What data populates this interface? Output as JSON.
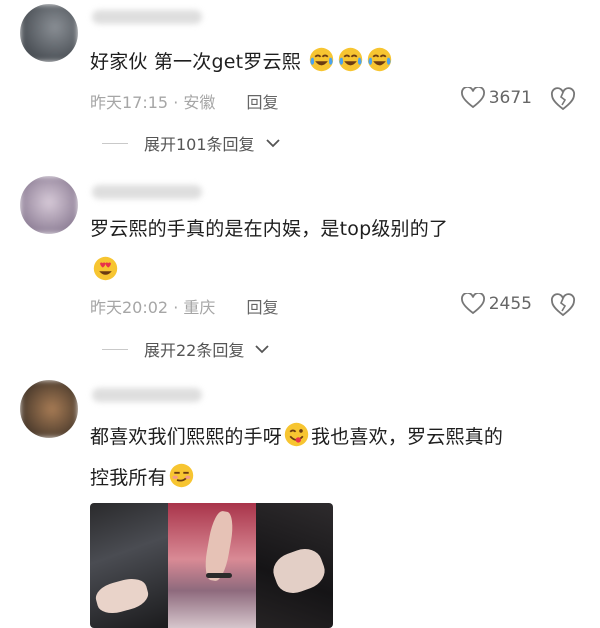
{
  "comments": [
    {
      "text": "好家伙 第一次get罗云熙",
      "emoji": "crying-laughing-emoji",
      "time": "昨天17:15",
      "location": "安徽",
      "reply_label": "回复",
      "likes": "3671",
      "expand": "展开101条回复"
    },
    {
      "text": "罗云熙的手真的是在内娱，是top级别的了",
      "emoji": "heart-eyes-emoji",
      "time": "昨天20:02",
      "location": "重庆",
      "reply_label": "回复",
      "likes": "2455",
      "expand": "展开22条回复"
    },
    {
      "line1_a": "都喜欢我们熙熙的手呀",
      "line1_b": "我也喜欢，罗云熙真的",
      "line2": "控我所有",
      "emoji1": "winking-tongue-emoji",
      "emoji2": "smirking-emoji"
    }
  ],
  "separator": "·",
  "colors": {
    "meta": "#a6a6a6",
    "text": "#1e1e1e",
    "emoji_yellow": "#f7c531"
  }
}
